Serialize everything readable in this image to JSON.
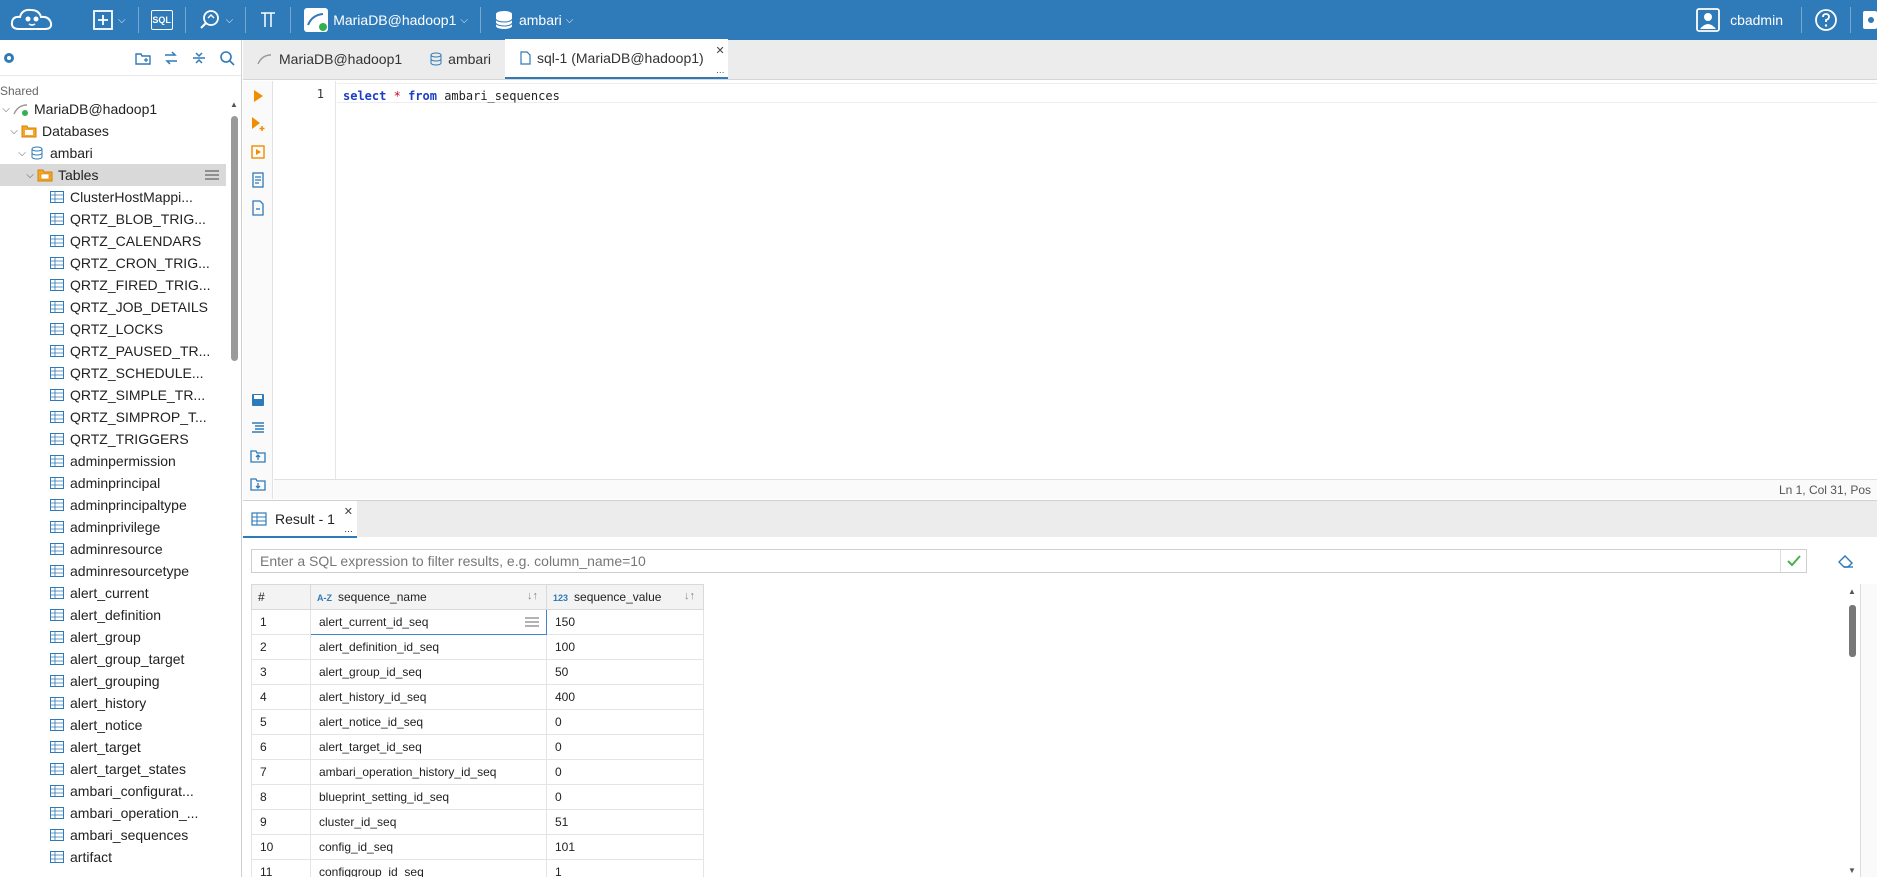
{
  "topbar": {
    "connection": "MariaDB@hadoop1",
    "database": "ambari",
    "user": "cbadmin",
    "sql_label": "SQL"
  },
  "navigator": {
    "shared_label": "Shared",
    "connection": "MariaDB@hadoop1",
    "databases_label": "Databases",
    "schema": "ambari",
    "tables_label": "Tables",
    "tables": [
      "ClusterHostMappi...",
      "QRTZ_BLOB_TRIG...",
      "QRTZ_CALENDARS",
      "QRTZ_CRON_TRIG...",
      "QRTZ_FIRED_TRIG...",
      "QRTZ_JOB_DETAILS",
      "QRTZ_LOCKS",
      "QRTZ_PAUSED_TR...",
      "QRTZ_SCHEDULE...",
      "QRTZ_SIMPLE_TR...",
      "QRTZ_SIMPROP_T...",
      "QRTZ_TRIGGERS",
      "adminpermission",
      "adminprincipal",
      "adminprincipaltype",
      "adminprivilege",
      "adminresource",
      "adminresourcetype",
      "alert_current",
      "alert_definition",
      "alert_group",
      "alert_group_target",
      "alert_grouping",
      "alert_history",
      "alert_notice",
      "alert_target",
      "alert_target_states",
      "ambari_configurat...",
      "ambari_operation_...",
      "ambari_sequences",
      "artifact"
    ]
  },
  "editor_tabs": [
    {
      "label": "MariaDB@hadoop1",
      "icon": "connection-icon"
    },
    {
      "label": "ambari",
      "icon": "database-icon"
    },
    {
      "label": "sql-1 (MariaDB@hadoop1)",
      "icon": "sql-file-icon",
      "active": true
    }
  ],
  "editor": {
    "line_number": "1",
    "sql_keyword_select": "select",
    "sql_star": "*",
    "sql_keyword_from": "from",
    "sql_table": "ambari_sequences",
    "cursor_status": "Ln 1, Col 31, Pos"
  },
  "result": {
    "tab_label": "Result - 1",
    "filter_placeholder": "Enter a SQL expression to filter results, e.g. column_name=10",
    "columns": [
      {
        "label": "#",
        "type": ""
      },
      {
        "label": "sequence_name",
        "type": "A-Z"
      },
      {
        "label": "sequence_value",
        "type": "123"
      }
    ],
    "rows": [
      {
        "n": "1",
        "name": "alert_current_id_seq",
        "value": "150"
      },
      {
        "n": "2",
        "name": "alert_definition_id_seq",
        "value": "100"
      },
      {
        "n": "3",
        "name": "alert_group_id_seq",
        "value": "50"
      },
      {
        "n": "4",
        "name": "alert_history_id_seq",
        "value": "400"
      },
      {
        "n": "5",
        "name": "alert_notice_id_seq",
        "value": "0"
      },
      {
        "n": "6",
        "name": "alert_target_id_seq",
        "value": "0"
      },
      {
        "n": "7",
        "name": "ambari_operation_history_id_seq",
        "value": "0"
      },
      {
        "n": "8",
        "name": "blueprint_setting_id_seq",
        "value": "0"
      },
      {
        "n": "9",
        "name": "cluster_id_seq",
        "value": "51"
      },
      {
        "n": "10",
        "name": "config_id_seq",
        "value": "101"
      },
      {
        "n": "11",
        "name": "configgroup_id_seq",
        "value": "1"
      }
    ]
  },
  "colors": {
    "topbar": "#2f7ab8",
    "accent_orange": "#f28c00",
    "selection": "#d9d9d9"
  }
}
